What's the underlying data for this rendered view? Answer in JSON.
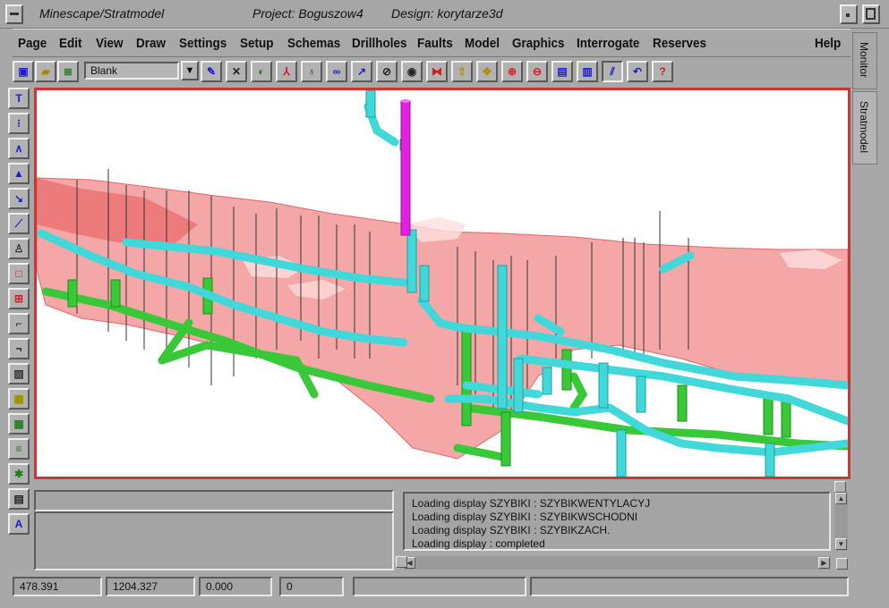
{
  "window": {
    "app_title": "Minescape/Stratmodel",
    "project_text": "Project: Boguszow4",
    "design_text": "Design: korytarze3d"
  },
  "menu": [
    {
      "label": "Page"
    },
    {
      "label": "Edit"
    },
    {
      "label": "View"
    },
    {
      "label": "Draw"
    },
    {
      "label": "Settings"
    },
    {
      "label": "Setup"
    },
    {
      "label": "Schemas"
    },
    {
      "label": "Drillholes"
    },
    {
      "label": "Faults"
    },
    {
      "label": "Model"
    },
    {
      "label": "Graphics"
    },
    {
      "label": "Interrogate"
    },
    {
      "label": "Reserves"
    },
    {
      "label": "Help"
    }
  ],
  "toolbar": {
    "layer_select_value": "Blank",
    "icons": [
      "open-display-icon",
      "open-folder-icon",
      "layers-icon",
      "pencil-icon",
      "cross-tool-icon",
      "rotate-icon",
      "pdf-icon",
      "lamp-icon",
      "glasses-icon",
      "pointer-icon",
      "hide-eye-icon",
      "eye-icon",
      "fit-icon",
      "upload-icon",
      "pan-icon",
      "zoom-in-icon",
      "zoom-out-icon",
      "horizontal-split-icon",
      "vertical-split-icon",
      "section-icon",
      "undo-icon",
      "query-icon"
    ]
  },
  "left_tools": [
    "text-tool-icon",
    "points-tool-icon",
    "polyline-tool-icon",
    "fill-tool-icon",
    "arrow-tool-icon",
    "edit-line-tool-icon",
    "symbol-tool-icon",
    "box-tool-icon",
    "box-delete-tool-icon",
    "step-tool-icon",
    "step-down-tool-icon",
    "hatch-tool-icon",
    "pattern-tool-icon",
    "grid-tool-icon",
    "grid-lines-tool-icon",
    "star-tool-icon",
    "document-tool-icon",
    "pen-tool-icon"
  ],
  "tabs": {
    "monitor": "Monitor",
    "stratmodel": "Stratmodel"
  },
  "log_lines": [
    "Loading display SZYBIKI : SZYBIKWENTYLACYJ",
    "Loading display SZYBIKI : SZYBIKWSCHODNI",
    "Loading display SZYBIKI : SZYBIKZACH.",
    "Loading display :  completed"
  ],
  "status": {
    "x": "478.391",
    "y": "1204.327",
    "z": "0.000",
    "count": "0"
  },
  "colors": {
    "surface_red": "#f07878",
    "tunnel_cyan": "#40d8d8",
    "tunnel_green": "#38c838",
    "shaft_magenta": "#e020e0",
    "viewport_border": "#c83838"
  }
}
